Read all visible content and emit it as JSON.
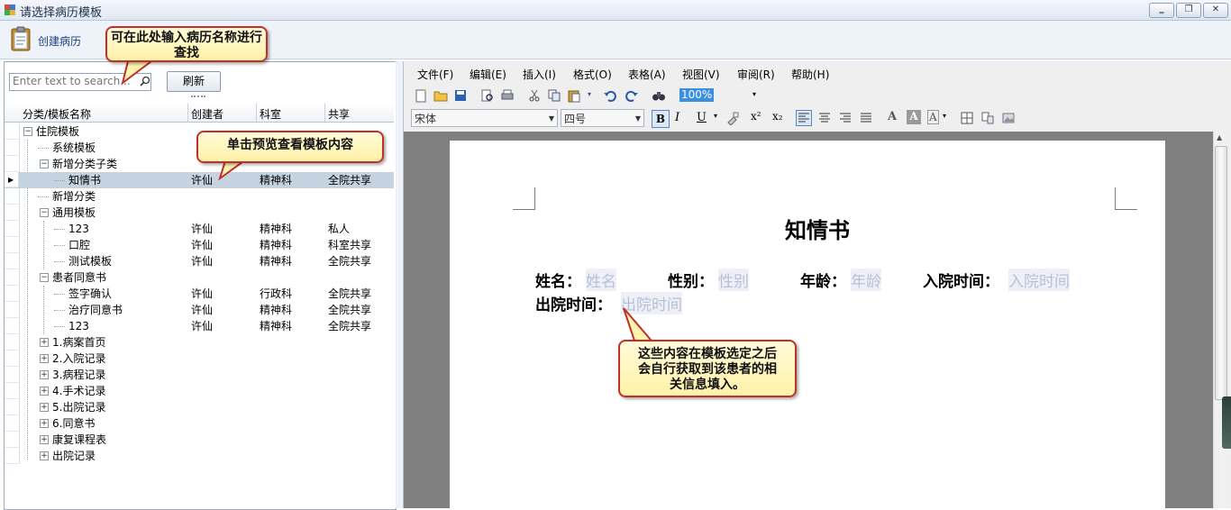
{
  "window": {
    "title": "请选择病历模板",
    "min": "‗",
    "max": "❐",
    "close": "✕"
  },
  "toolbar": {
    "create_label": "创建病历"
  },
  "left": {
    "search_placeholder": "Enter text to search...",
    "refresh_label": "刷新",
    "columns": [
      "分类/模板名称",
      "创建者",
      "科室",
      "共享"
    ],
    "rows": [
      {
        "name": "住院模板",
        "creator": "",
        "dept": "",
        "share": ""
      },
      {
        "name": "系统模板",
        "creator": "",
        "dept": "",
        "share": ""
      },
      {
        "name": "新增分类子类",
        "creator": "",
        "dept": "",
        "share": ""
      },
      {
        "name": "知情书",
        "creator": "许仙",
        "dept": "精神科",
        "share": "全院共享"
      },
      {
        "name": "新增分类",
        "creator": "",
        "dept": "",
        "share": ""
      },
      {
        "name": "通用模板",
        "creator": "",
        "dept": "",
        "share": ""
      },
      {
        "name": "123",
        "creator": "许仙",
        "dept": "精神科",
        "share": "私人"
      },
      {
        "name": "口腔",
        "creator": "许仙",
        "dept": "精神科",
        "share": "科室共享"
      },
      {
        "name": "测试模板",
        "creator": "许仙",
        "dept": "精神科",
        "share": "全院共享"
      },
      {
        "name": "患者同意书",
        "creator": "",
        "dept": "",
        "share": ""
      },
      {
        "name": "签字确认",
        "creator": "许仙",
        "dept": "行政科",
        "share": "全院共享"
      },
      {
        "name": "治疗同意书",
        "creator": "许仙",
        "dept": "精神科",
        "share": "全院共享"
      },
      {
        "name": "123",
        "creator": "许仙",
        "dept": "精神科",
        "share": "全院共享"
      },
      {
        "name": "1.病案首页",
        "creator": "",
        "dept": "",
        "share": ""
      },
      {
        "name": "2.入院记录",
        "creator": "",
        "dept": "",
        "share": ""
      },
      {
        "name": "3.病程记录",
        "creator": "",
        "dept": "",
        "share": ""
      },
      {
        "name": "4.手术记录",
        "creator": "",
        "dept": "",
        "share": ""
      },
      {
        "name": "5.出院记录",
        "creator": "",
        "dept": "",
        "share": ""
      },
      {
        "name": "6.同意书",
        "creator": "",
        "dept": "",
        "share": ""
      },
      {
        "name": "康复课程表",
        "creator": "",
        "dept": "",
        "share": ""
      },
      {
        "name": "出院记录",
        "creator": "",
        "dept": "",
        "share": ""
      }
    ]
  },
  "editor": {
    "menus": [
      "文件(F)",
      "编辑(E)",
      "插入(I)",
      "格式(O)",
      "表格(A)",
      "视图(V)",
      "审阅(R)",
      "帮助(H)"
    ],
    "zoom": "100%",
    "font_name": "宋体",
    "font_size": "四号",
    "doc": {
      "title": "知情书",
      "fields": [
        {
          "label": "姓名：",
          "value": "姓名"
        },
        {
          "label": "性别：",
          "value": "性别"
        },
        {
          "label": "年龄：",
          "value": "年龄"
        },
        {
          "label": "入院时间：",
          "value": "入院时间"
        },
        {
          "label": "出院时间：",
          "value": "出院时间"
        }
      ]
    }
  },
  "callouts": {
    "search_tip": "可在此处输入病历名称进行查找",
    "preview_tip": "单击预览查看模板内容",
    "autofill_tip": "这些内容在模板选定之后会自行获取到该患者的相关信息填入。"
  },
  "colors": {
    "accent": "#1a3f86",
    "callout_border": "#c0302a",
    "callout_fill": "#fff5bb",
    "selected_row": "#c5d3e1"
  }
}
